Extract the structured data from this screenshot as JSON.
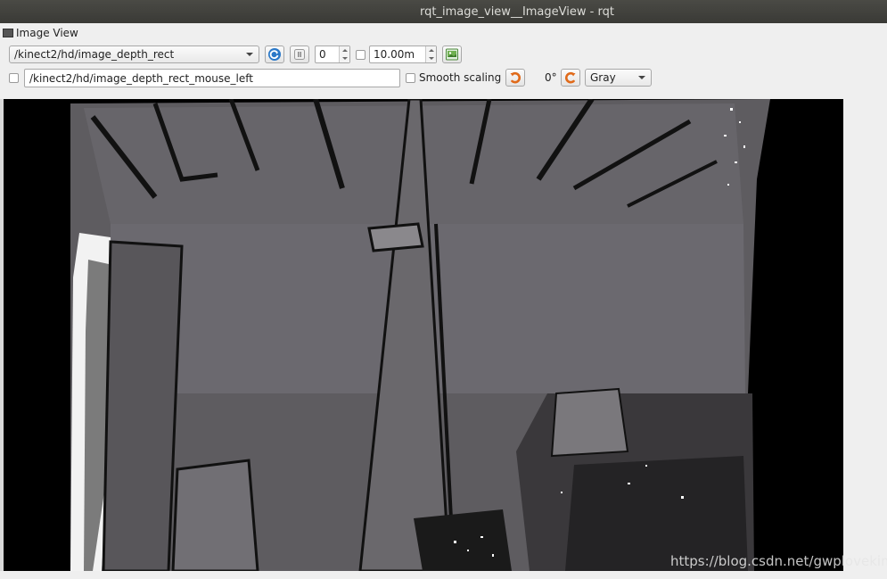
{
  "window": {
    "title": "rqt_image_view__ImageView - rqt"
  },
  "panel": {
    "title": "Image View"
  },
  "toolbar": {
    "topic": "/kinect2/hd/image_depth_rect",
    "min_value": "0",
    "max_value": "10.00m",
    "mouse_topic": "/kinect2/hd/image_depth_rect_mouse_left",
    "smooth_scaling_label": "Smooth scaling",
    "rotation_label": "0°",
    "color_scheme": "Gray"
  },
  "icons": {
    "refresh": "refresh-icon",
    "pause": "pause-icon",
    "save": "save-image-icon",
    "rotate_left": "rotate-left-icon",
    "rotate_right": "rotate-right-icon"
  },
  "colors": {
    "titlebar": "#3d3d39",
    "accent": "#e06a1a",
    "blue": "#2a78c8"
  },
  "watermark": "https://blog.csdn.net/gwplovekimi"
}
